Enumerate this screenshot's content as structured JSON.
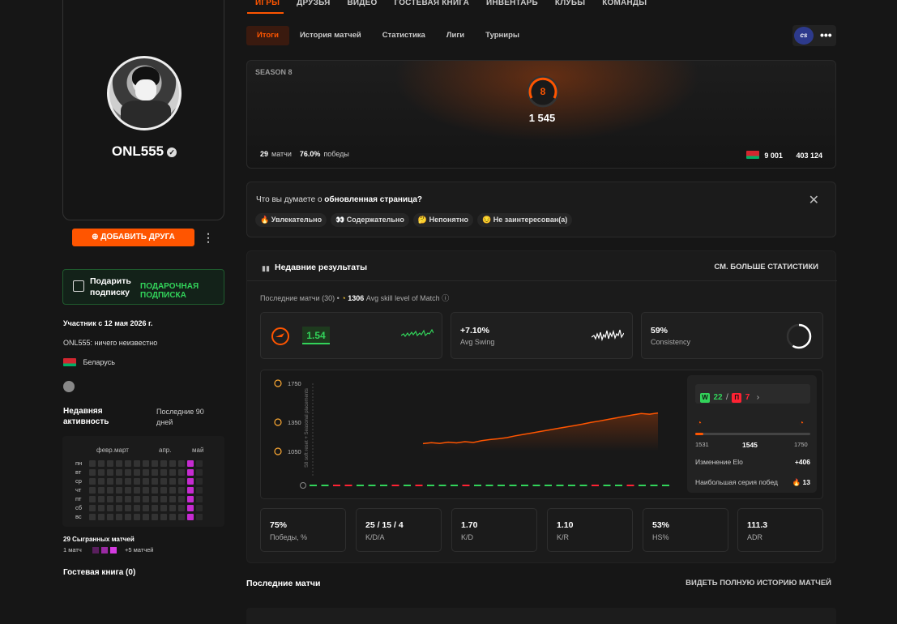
{
  "profile": {
    "nickname": "ONL555",
    "add_friend_label": "ДОБАВИТЬ ДРУГА",
    "gift": {
      "label": "Подарить подписку",
      "sublabel": "ПОДАРОЧНАЯ ПОДПИСКА"
    },
    "member_since": "Участник с 12 мая 2026 г.",
    "bio": "ONL555: ничего неизвестно",
    "country": "Беларусь"
  },
  "activity": {
    "title": "Недавняя активность",
    "period": "Последние 90 дней",
    "months": [
      "февр.",
      "март",
      "апр.",
      "май"
    ],
    "days": [
      "пн",
      "вт",
      "ср",
      "чт",
      "пт",
      "сб",
      "вс"
    ],
    "matches_played": "29 Сыгранных матчей",
    "legend_min": "1 матч",
    "legend_max": "+5 матчей",
    "active_color": "#c62bd1"
  },
  "guestbook": "Гостевая книга (0)",
  "nav": {
    "items": [
      "ИГРЫ",
      "ДРУЗЬЯ",
      "ВИДЕО",
      "ГОСТЕВАЯ КНИГА",
      "ИНВЕНТАРЬ",
      "КЛУБЫ",
      "КОМАНДЫ"
    ],
    "active": "ИГРЫ"
  },
  "subtabs": [
    "Итоги",
    "История матчей",
    "Статистика",
    "Лиги",
    "Турниры"
  ],
  "game_badge": "cs",
  "season": {
    "label": "SEASON 8",
    "level": "8",
    "elo": "1 545",
    "matches": "29",
    "matches_label": "матчи",
    "winrate": "76.0%",
    "winrate_label": "победы",
    "rank_country": "9 001",
    "rank_global": "403 124"
  },
  "feedback": {
    "question_prefix": "Что вы думаете о",
    "question_subject": "обновленная страница?",
    "options": [
      "🔥 Увлекательно",
      "👀 Содержательно",
      "🤔 Непонятно",
      "😔 Не заинтересован(а)"
    ]
  },
  "recent": {
    "title": "Недавние результаты",
    "more": "СМ. БОЛЬШЕ СТАТИСТИКИ",
    "sub_prefix": "Последние матчи (30)",
    "avg_skill_value": "1306",
    "avg_skill_label": "Avg skill level of Match",
    "kpis": [
      {
        "value": "1.54",
        "label": ""
      },
      {
        "value": "+7.10%",
        "label": "Avg Swing"
      },
      {
        "value": "59%",
        "label": "Consistency"
      }
    ],
    "chart_data": {
      "type": "line",
      "yticks": [
        1750,
        1350,
        1050
      ],
      "annotation": "S8 soft reset + Seasonal placements",
      "x": [
        1,
        2,
        3,
        4,
        5,
        6,
        7,
        8,
        9,
        10,
        11,
        12,
        13,
        14,
        15,
        16,
        17,
        18,
        19,
        20,
        21,
        22,
        23,
        24,
        25,
        26,
        27,
        28,
        29
      ],
      "values": [
        1130,
        1140,
        1132,
        1145,
        1138,
        1150,
        1142,
        1160,
        1172,
        1180,
        1192,
        1210,
        1225,
        1240,
        1255,
        1270,
        1285,
        1300,
        1315,
        1330,
        1348,
        1362,
        1378,
        1394,
        1410,
        1425,
        1440,
        1432,
        1445
      ],
      "results": [
        "W",
        "W",
        "L",
        "L",
        "W",
        "W",
        "W",
        "L",
        "W",
        "L",
        "W",
        "W",
        "W",
        "L",
        "W",
        "W",
        "W",
        "W",
        "W",
        "W",
        "W",
        "W",
        "W",
        "W",
        "L",
        "W",
        "W",
        "L",
        "W",
        "W",
        "W"
      ]
    },
    "wl": {
      "wins": "22",
      "losses": "7",
      "w_letter": "W",
      "l_letter": "П"
    },
    "elo_range": {
      "min": "1531",
      "current": "1545",
      "max": "1750",
      "fill": 0.07
    },
    "elo_change_label": "Изменение Elo",
    "elo_change": "+406",
    "streak_label": "Наибольшая серия побед",
    "streak": "13",
    "stats": [
      {
        "value": "75%",
        "label": "Победы, %"
      },
      {
        "value": "25 / 15 / 4",
        "label": "K/D/A"
      },
      {
        "value": "1.70",
        "label": "K/D"
      },
      {
        "value": "1.10",
        "label": "K/R"
      },
      {
        "value": "53%",
        "label": "HS%"
      },
      {
        "value": "111.3",
        "label": "ADR"
      }
    ]
  },
  "last_matches": {
    "title": "Последние матчи",
    "link": "ВИДЕТЬ ПОЛНУЮ ИСТОРИЮ МАТЧЕЙ"
  },
  "colors": {
    "accent": "#ff5500",
    "win": "#32d35a",
    "loss": "#ff2233"
  }
}
